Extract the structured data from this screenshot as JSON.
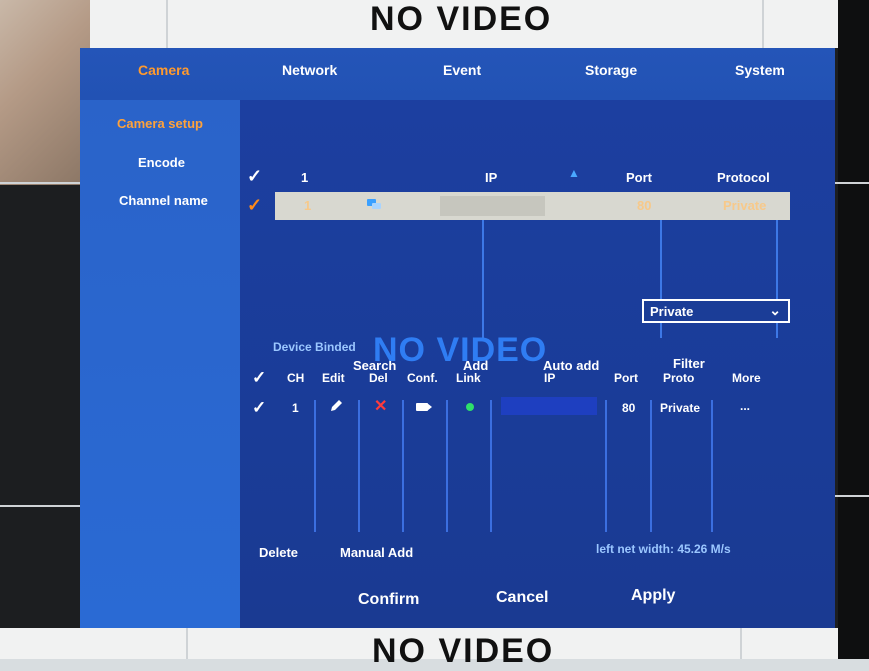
{
  "background": {
    "no_video_top": "NO VIDEO",
    "no_video_bottom": "NO VIDEO"
  },
  "tabs": [
    {
      "label": "Camera",
      "active": true
    },
    {
      "label": "Network"
    },
    {
      "label": "Event"
    },
    {
      "label": "Storage"
    },
    {
      "label": "System"
    }
  ],
  "sidebar": {
    "items": [
      {
        "label": "Camera setup",
        "active": true
      },
      {
        "label": "Encode"
      },
      {
        "label": "Channel name"
      }
    ]
  },
  "scan_table": {
    "headers": {
      "col1": "1",
      "ip": "IP",
      "port": "Port",
      "protocol": "Protocol"
    },
    "sort_icon": "triangle-up-icon",
    "row": {
      "num": "1",
      "port": "80",
      "protocol": "Private"
    }
  },
  "actions": {
    "search": "Search",
    "add": "Add",
    "auto_add": "Auto add",
    "filter_label": "Filter",
    "filter_value": "Private"
  },
  "overlay": {
    "no_video": "NO VIDEO"
  },
  "binded": {
    "title": "Device Binded",
    "headers": {
      "ch": "CH",
      "edit": "Edit",
      "del": "Del",
      "conf": "Conf.",
      "link": "Link",
      "ip": "IP",
      "port": "Port",
      "proto": "Proto",
      "more": "More"
    },
    "row": {
      "ch": "1",
      "port": "80",
      "proto": "Private",
      "more": "..."
    }
  },
  "bottom": {
    "delete": "Delete",
    "manual_add": "Manual Add",
    "net_width": "left net width:  45.26 M/s",
    "confirm": "Confirm",
    "cancel": "Cancel",
    "apply": "Apply"
  },
  "colors": {
    "accent": "#ff9a2e",
    "panel": "#1c3fa0",
    "nav": "#2455b8"
  }
}
